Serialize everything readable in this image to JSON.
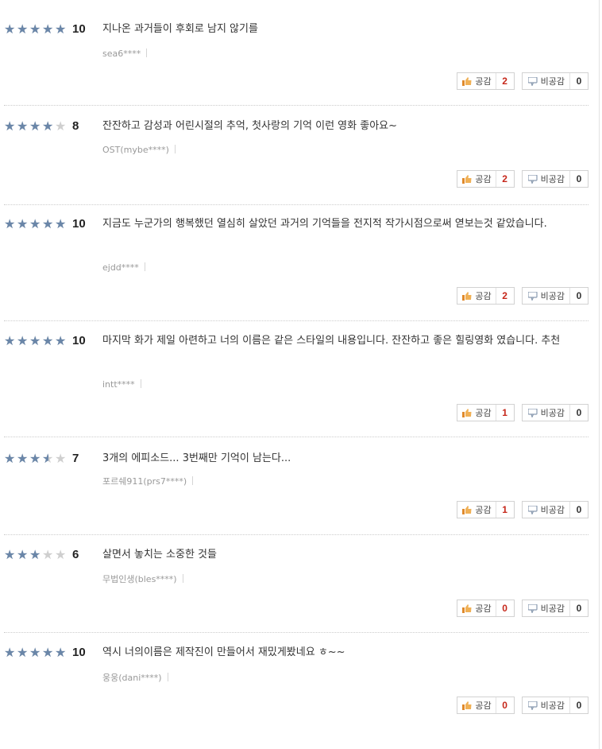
{
  "reviews": [
    {
      "rating": 10,
      "stars": 5,
      "score": "10",
      "text": "지나온 과거들이 후회로 남지 않기를",
      "author": "sea6****",
      "like_label": "공감",
      "likes": "2",
      "dislike_label": "비공감",
      "dislikes": "0"
    },
    {
      "rating": 8,
      "stars": 4,
      "score": "8",
      "text": "잔잔하고 감성과 어린시절의 추억, 첫사랑의 기억 이런 영화 좋아요~",
      "author": "OST(mybe****)",
      "like_label": "공감",
      "likes": "2",
      "dislike_label": "비공감",
      "dislikes": "0"
    },
    {
      "rating": 10,
      "stars": 5,
      "score": "10",
      "text": "지금도 누군가의 행복했던 열심히 살았던 과거의 기억들을 전지적 작가시점으로써 엳보는것 같았습니다.",
      "author": "ejdd****",
      "like_label": "공감",
      "likes": "2",
      "dislike_label": "비공감",
      "dislikes": "0"
    },
    {
      "rating": 10,
      "stars": 5,
      "score": "10",
      "text": "마지막 화가 제일 아련하고 너의 이름은 같은 스타일의 내용입니다. 잔잔하고 좋은 힐링영화 였습니다. 추천",
      "author": "intt****",
      "like_label": "공감",
      "likes": "1",
      "dislike_label": "비공감",
      "dislikes": "0"
    },
    {
      "rating": 7,
      "stars": 3.5,
      "score": "7",
      "text": "3개의 에피소드... 3번째만 기억이 남는다...",
      "author": "포르쉐911(prs7****)",
      "like_label": "공감",
      "likes": "1",
      "dislike_label": "비공감",
      "dislikes": "0"
    },
    {
      "rating": 6,
      "stars": 3,
      "score": "6",
      "text": "살면서 놓치는 소중한 것들",
      "author": "무법인생(bles****)",
      "like_label": "공감",
      "likes": "0",
      "dislike_label": "비공감",
      "dislikes": "0"
    },
    {
      "rating": 10,
      "stars": 5,
      "score": "10",
      "text": "역시 너의이름은 제작진이 만들어서 재밌게봤네요 ㅎ~~",
      "author": "웅웅(dani****)",
      "like_label": "공감",
      "likes": "0",
      "dislike_label": "비공감",
      "dislikes": "0"
    }
  ],
  "colors": {
    "star_filled": "#6a86a8",
    "star_empty": "#cfcfcf",
    "like_count": "#c6271a",
    "like_icon": "#e08a2c",
    "dislike_icon": "#8a9bb0"
  },
  "icons": {
    "like": "thumbs-up-icon",
    "dislike": "thumbs-down-icon",
    "star": "star-icon"
  }
}
